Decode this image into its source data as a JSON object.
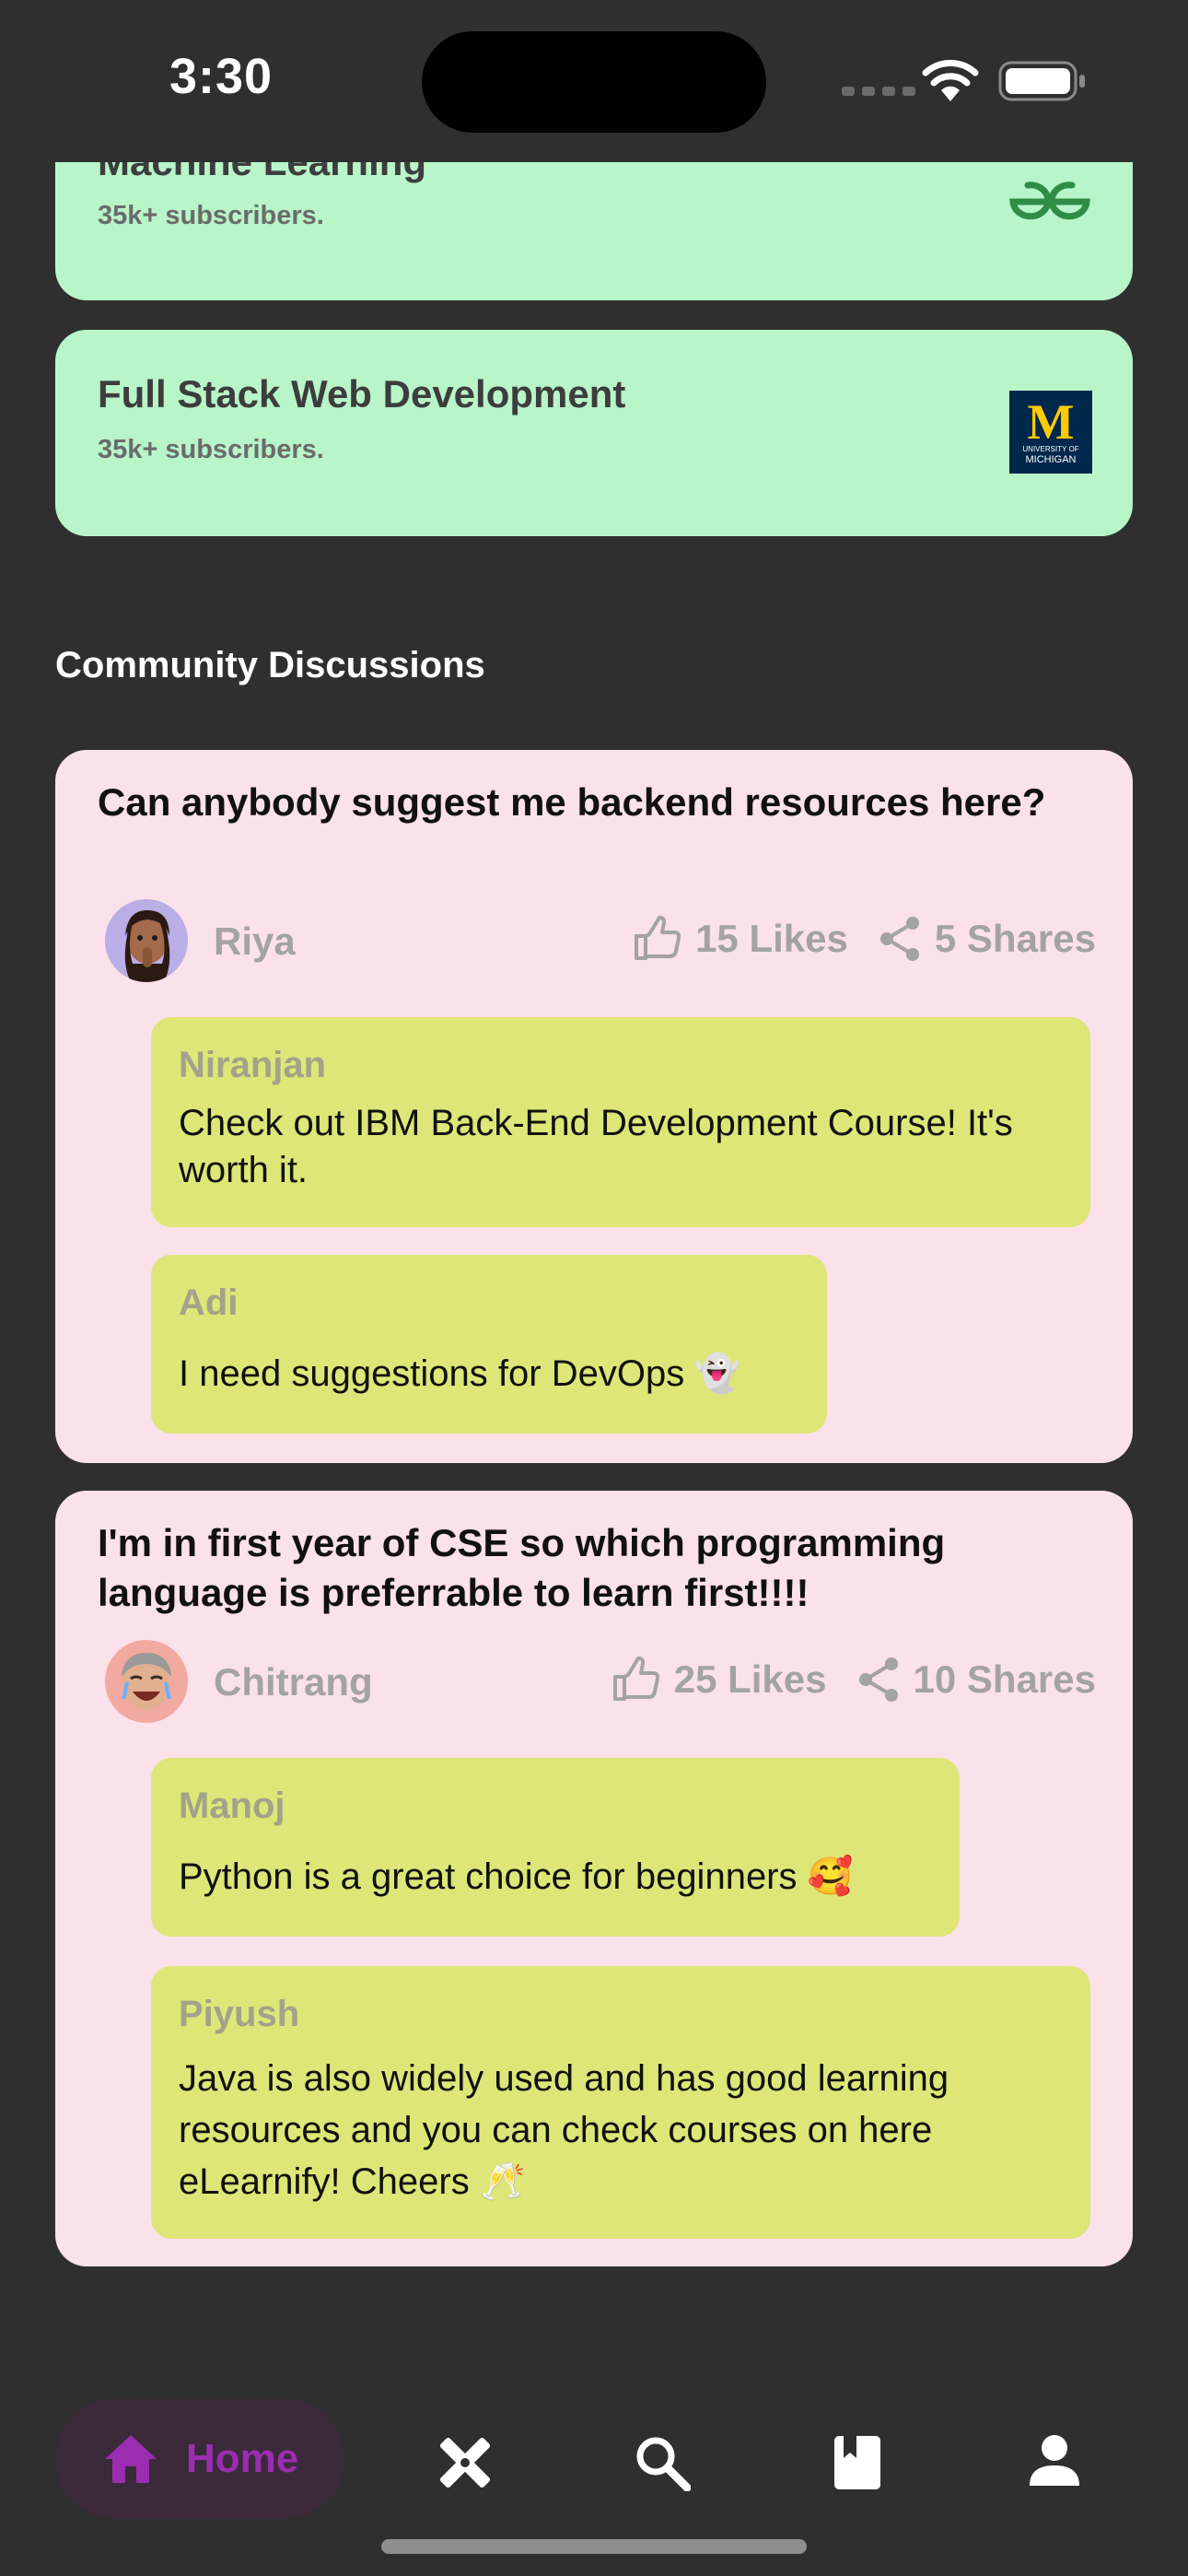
{
  "status_bar": {
    "time": "3:30"
  },
  "courses": [
    {
      "title": "Machine Learning",
      "subscribers": "35k+ subscribers.",
      "logo": "geeksforgeeks-logo"
    },
    {
      "title": "Full Stack Web Development",
      "subscribers": "35k+ subscribers.",
      "logo": "university-of-michigan-logo",
      "logo_text": {
        "letter": "M",
        "line1": "UNIVERSITY OF",
        "line2": "MICHIGAN"
      }
    }
  ],
  "section_title": "Community Discussions",
  "discussions": [
    {
      "question": "Can anybody suggest me backend resources here?",
      "author": "Riya",
      "likes": "15 Likes",
      "shares": "5 Shares",
      "replies": [
        {
          "name": "Niranjan",
          "text": "Check out IBM Back-End Development Course! It's worth it."
        },
        {
          "name": "Adi",
          "text": "I need suggestions for DevOps 👻"
        }
      ]
    },
    {
      "question": "I'm in first year of CSE so which programming language is preferrable to learn first!!!!",
      "author": "Chitrang",
      "likes": "25 Likes",
      "shares": "10 Shares",
      "replies": [
        {
          "name": "Manoj",
          "text": "Python is a great choice for beginners 🥰"
        },
        {
          "name": "Piyush",
          "text": "Java is also widely used and has good learning resources and you can check courses on here eLearnify! Cheers 🥂"
        }
      ]
    }
  ],
  "nav": {
    "home_label": "Home",
    "active": "home",
    "items": [
      "home-icon",
      "tools-icon",
      "search-icon",
      "book-icon",
      "profile-icon"
    ]
  },
  "colors": {
    "course_card": "#b8f5c9",
    "discussion_card": "#fbe1ea",
    "reply_bubble": "#dee677",
    "accent": "#9a2db0",
    "background": "#2f2f2f"
  }
}
